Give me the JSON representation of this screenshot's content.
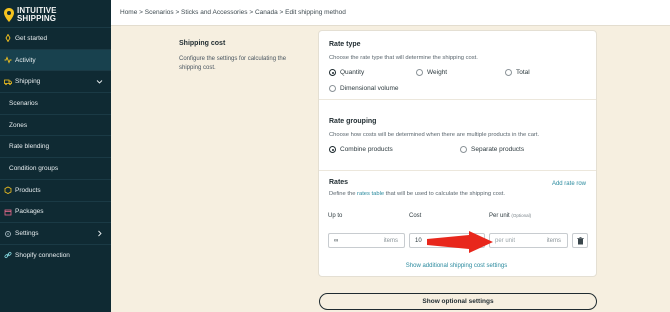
{
  "brand": {
    "line1": "INTUITIVE",
    "line2": "SHIPPING"
  },
  "breadcrumb": "Home > Scenarios > Sticks and Accessories > Canada > Edit shipping method",
  "sidebar": {
    "items": [
      {
        "label": "Get started",
        "icon": "rocket-icon"
      },
      {
        "label": "Activity",
        "icon": "activity-icon"
      },
      {
        "label": "Shipping",
        "icon": "truck-icon",
        "expanded": true
      },
      {
        "label": "Scenarios"
      },
      {
        "label": "Zones"
      },
      {
        "label": "Rate blending"
      },
      {
        "label": "Condition groups"
      },
      {
        "label": "Products",
        "icon": "box-icon"
      },
      {
        "label": "Packages",
        "icon": "package-icon"
      },
      {
        "label": "Settings",
        "icon": "gear-icon"
      },
      {
        "label": "Shopify connection",
        "icon": "link-icon"
      }
    ]
  },
  "left_panel": {
    "title": "Shipping cost",
    "description": "Configure the settings for calculating the shipping cost."
  },
  "rate_type": {
    "title": "Rate type",
    "description": "Choose the rate type that will determine the shipping cost.",
    "options": [
      "Quantity",
      "Weight",
      "Total",
      "Dimensional volume"
    ],
    "selected": "Quantity"
  },
  "rate_grouping": {
    "title": "Rate grouping",
    "description": "Choose how costs will be determined when there are multiple products in the cart.",
    "options": [
      "Combine products",
      "Separate products"
    ],
    "selected": "Combine products"
  },
  "rates": {
    "title": "Rates",
    "description_before": "Define the ",
    "description_link": "rates table",
    "description_after": " that will be used to calculate the shipping cost.",
    "add_label": "Add rate row",
    "columns": {
      "up_to": "Up to",
      "cost": "Cost",
      "per_unit": "Per unit",
      "optional": "(Optional)"
    },
    "row": {
      "up_to_value": "∞",
      "up_to_unit": "items",
      "cost_value": "10",
      "per_unit_placeholder": "per unit",
      "per_unit_unit": "items"
    },
    "show_additional": "Show additional shipping cost settings"
  },
  "optional_button": "Show optional settings",
  "colors": {
    "sidebar_bg": "#0f2a33",
    "accent_link": "#2a8a9e",
    "page_bg": "#f6efe0",
    "arrow_red": "#e8271c",
    "logo_yellow": "#f4c21f"
  }
}
